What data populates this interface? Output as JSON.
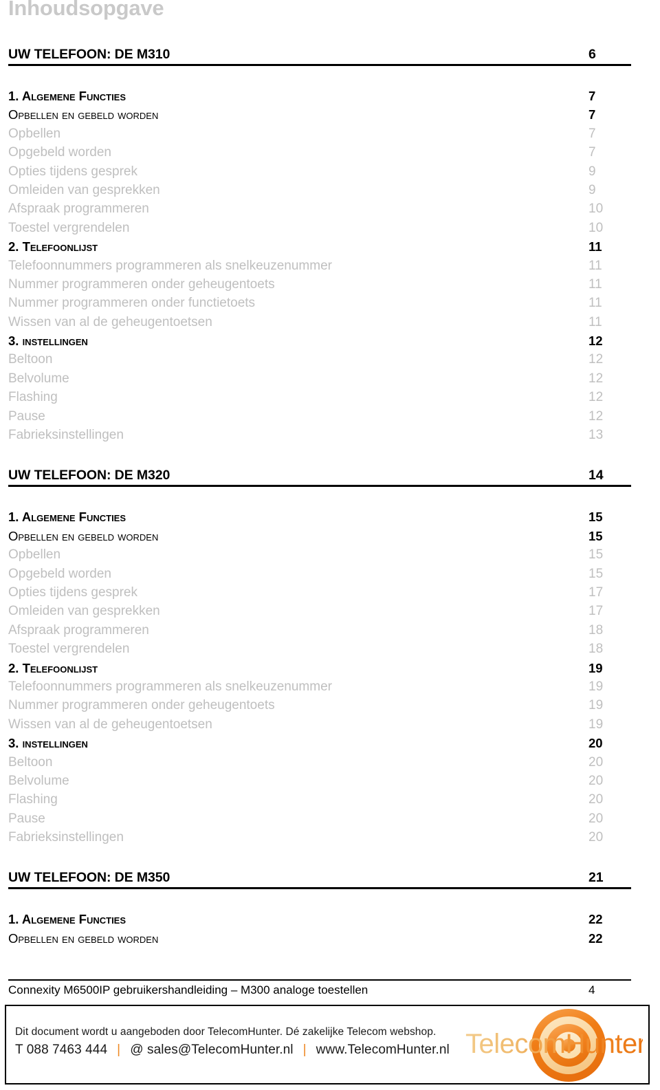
{
  "document": {
    "toc_title": "Inhoudsopgave"
  },
  "toc": {
    "sections": [
      {
        "heading": {
          "label": "UW TELEFOON: DE M310",
          "page": "6"
        },
        "entries": [
          {
            "level": 1,
            "label": "1. Algemene Functies",
            "page": "7"
          },
          {
            "level": 2,
            "label": "Opbellen en gebeld worden",
            "page": "7"
          },
          {
            "level": 3,
            "label": "Opbellen",
            "page": "7"
          },
          {
            "level": 3,
            "label": "Opgebeld worden",
            "page": "7"
          },
          {
            "level": 3,
            "label": "Opties tijdens gesprek",
            "page": "9"
          },
          {
            "level": 3,
            "label": "Omleiden van gesprekken",
            "page": "9"
          },
          {
            "level": 3,
            "label": "Afspraak programmeren",
            "page": "10"
          },
          {
            "level": 3,
            "label": "Toestel vergrendelen",
            "page": "10"
          },
          {
            "level": 1,
            "label": "2. Telefoonlijst",
            "page": "11"
          },
          {
            "level": 3,
            "label": "Telefoonnummers programmeren als snelkeuzenummer",
            "page": "11"
          },
          {
            "level": 3,
            "label": "Nummer programmeren onder geheugentoets",
            "page": "11"
          },
          {
            "level": 3,
            "label": "Nummer programmeren onder functietoets",
            "page": "11"
          },
          {
            "level": 3,
            "label": "Wissen van al de geheugentoetsen",
            "page": "11"
          },
          {
            "level": 1,
            "label": "3. instellingen",
            "page": "12"
          },
          {
            "level": 3,
            "label": "Beltoon",
            "page": "12"
          },
          {
            "level": 3,
            "label": "Belvolume",
            "page": "12"
          },
          {
            "level": 3,
            "label": "Flashing",
            "page": "12"
          },
          {
            "level": 3,
            "label": "Pause",
            "page": "12"
          },
          {
            "level": 3,
            "label": "Fabrieksinstellingen",
            "page": "13"
          }
        ]
      },
      {
        "heading": {
          "label": "UW TELEFOON: DE M320",
          "page": "14"
        },
        "entries": [
          {
            "level": 1,
            "label": "1. Algemene Functies",
            "page": "15"
          },
          {
            "level": 2,
            "label": "Opbellen en gebeld worden",
            "page": "15"
          },
          {
            "level": 3,
            "label": "Opbellen",
            "page": "15"
          },
          {
            "level": 3,
            "label": "Opgebeld worden",
            "page": "15"
          },
          {
            "level": 3,
            "label": "Opties tijdens gesprek",
            "page": "17"
          },
          {
            "level": 3,
            "label": "Omleiden van gesprekken",
            "page": "17"
          },
          {
            "level": 3,
            "label": "Afspraak programmeren",
            "page": "18"
          },
          {
            "level": 3,
            "label": "Toestel vergrendelen",
            "page": "18"
          },
          {
            "level": 1,
            "label": "2. Telefoonlijst",
            "page": "19"
          },
          {
            "level": 3,
            "label": "Telefoonnummers programmeren als snelkeuzenummer",
            "page": "19"
          },
          {
            "level": 3,
            "label": "Nummer programmeren onder geheugentoets",
            "page": "19"
          },
          {
            "level": 3,
            "label": "Wissen van al de geheugentoetsen",
            "page": "19"
          },
          {
            "level": 1,
            "label": "3. instellingen",
            "page": "20"
          },
          {
            "level": 3,
            "label": "Beltoon",
            "page": "20"
          },
          {
            "level": 3,
            "label": "Belvolume",
            "page": "20"
          },
          {
            "level": 3,
            "label": "Flashing",
            "page": "20"
          },
          {
            "level": 3,
            "label": "Pause",
            "page": "20"
          },
          {
            "level": 3,
            "label": "Fabrieksinstellingen",
            "page": "20"
          }
        ]
      },
      {
        "heading": {
          "label": "UW TELEFOON: DE M350",
          "page": "21"
        },
        "entries": [
          {
            "level": 1,
            "label": "1. Algemene Functies",
            "page": "22"
          },
          {
            "level": 2,
            "label": "Opbellen en gebeld worden",
            "page": "22"
          }
        ]
      }
    ]
  },
  "footer": {
    "text": "Connexity M6500IP gebruikershandleiding – M300 analoge toestellen",
    "page": "4"
  },
  "promo": {
    "line1": "Dit document wordt u aangeboden door TelecomHunter. Dé zakelijke Telecom webshop.",
    "phone": "T 088 7463 444",
    "email": "@ sales@TelecomHunter.nl",
    "website": "www.TelecomHunter.nl",
    "separator": "|",
    "logo_text_left": "Telecom",
    "logo_text_right": "Hunter",
    "colors": {
      "accent_orange": "#ee8822",
      "logo_dark_orange": "#e8700f",
      "logo_mid_orange": "#f79a3e",
      "logo_cream": "#fbdfae",
      "toc_grey": "#bfbfbf",
      "title_grey": "#c9c9c9"
    }
  }
}
